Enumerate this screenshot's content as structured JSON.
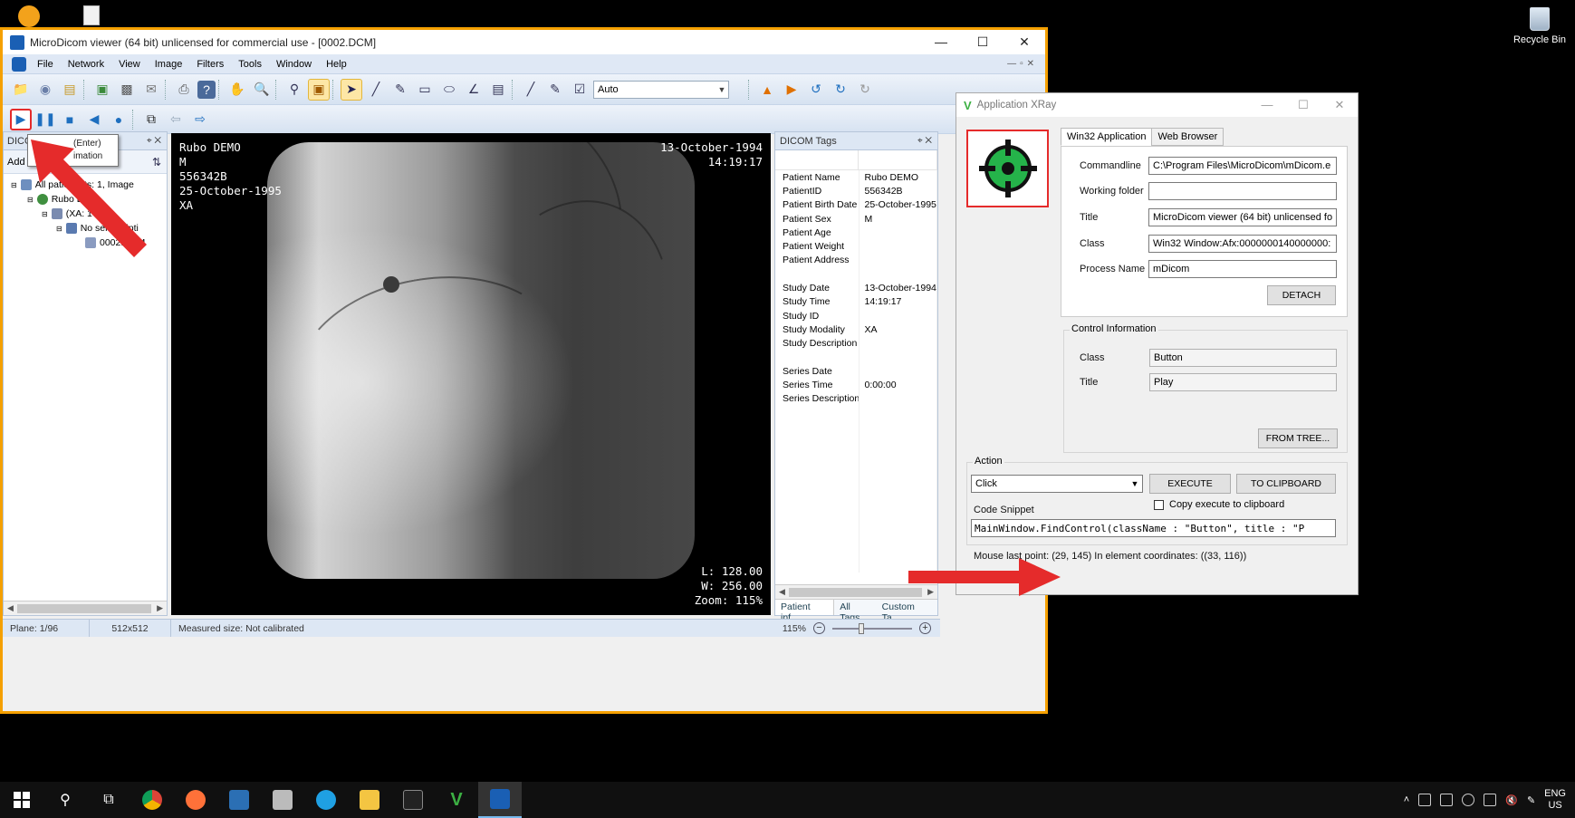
{
  "desktop": {
    "recycle_bin_label": "Recycle Bin"
  },
  "main_window": {
    "title": "MicroDicom viewer (64 bit) unlicensed for commercial use - [0002.DCM]",
    "menu": [
      "File",
      "Network",
      "View",
      "Image",
      "Filters",
      "Tools",
      "Window",
      "Help"
    ],
    "window_level_combo": "Auto",
    "tooltip": {
      "line1": "(Enter)",
      "line2": "imation"
    },
    "left_panel": {
      "title": "DICO",
      "add_label": "Add",
      "tree": [
        {
          "text": "All patie    ients: 1, Image",
          "level": 0
        },
        {
          "text": "Rubo De",
          "level": 1
        },
        {
          "text": "(XA: 1 se",
          "level": 2
        },
        {
          "text": "No serie    cripti",
          "level": 3
        },
        {
          "text": "0002.DCM",
          "level": 4
        }
      ]
    },
    "viewer": {
      "overlay_top_left": [
        "Rubo DEMO",
        "M",
        "556342B",
        "25-October-1995",
        "XA"
      ],
      "overlay_top_right": [
        "13-October-1994",
        "14:19:17"
      ],
      "overlay_bottom_right": [
        "L: 128.00",
        "W: 256.00",
        "Zoom: 115%"
      ]
    },
    "tags_panel": {
      "title": "DICOM Tags",
      "rows": [
        {
          "name": "Patient Name",
          "value": "Rubo DEMO"
        },
        {
          "name": "PatientID",
          "value": "556342B"
        },
        {
          "name": "Patient Birth Date",
          "value": "25-October-1995"
        },
        {
          "name": "Patient Sex",
          "value": "M"
        },
        {
          "name": "Patient Age",
          "value": ""
        },
        {
          "name": "Patient Weight",
          "value": ""
        },
        {
          "name": "Patient Address",
          "value": ""
        },
        {
          "name": "",
          "value": ""
        },
        {
          "name": "Study Date",
          "value": "13-October-1994"
        },
        {
          "name": "Study Time",
          "value": "14:19:17"
        },
        {
          "name": "Study ID",
          "value": ""
        },
        {
          "name": "Study Modality",
          "value": "XA"
        },
        {
          "name": "Study Description",
          "value": ""
        },
        {
          "name": "",
          "value": ""
        },
        {
          "name": "Series Date",
          "value": ""
        },
        {
          "name": "Series Time",
          "value": "0:00:00"
        },
        {
          "name": "Series Description",
          "value": ""
        }
      ],
      "tabs": [
        "Patient inf...",
        "All Tags",
        "Custom Ta..."
      ]
    },
    "status": {
      "plane": "Plane: 1/96",
      "size": "512x512",
      "measured": "Measured size: Not calibrated",
      "zoom": "115%",
      "zoom_slider_level": 0.35
    }
  },
  "xray_window": {
    "title": "Application XRay",
    "tabs": [
      "Win32 Application",
      "Web Browser"
    ],
    "fields": {
      "commandline_label": "Commandline",
      "commandline_value": "C:\\Program Files\\MicroDicom\\mDicom.e",
      "working_folder_label": "Working folder",
      "working_folder_value": "",
      "title_label": "Title",
      "title_value": "MicroDicom viewer (64 bit) unlicensed fo",
      "class_label": "Class",
      "class_value": "Win32 Window:Afx:0000000140000000:",
      "process_label": "Process Name",
      "process_value": "mDicom",
      "detach": "DETACH"
    },
    "control_info": {
      "group": "Control Information",
      "class_label": "Class",
      "class_value": "Button",
      "title_label": "Title",
      "title_value": "Play",
      "from_tree": "FROM TREE..."
    },
    "action": {
      "group": "Action",
      "selected": "Click",
      "execute": "EXECUTE",
      "to_clipboard": "TO CLIPBOARD",
      "copy_execute": "Copy execute to clipboard",
      "code_snippet_label": "Code Snippet",
      "code": "MainWindow.FindControl(className : \"Button\", title : \"P"
    },
    "mouse_info": "Mouse last point: (29, 145) In element coordinates: ((33, 116))",
    "ellipsis": "..."
  },
  "taskbar": {
    "lang_line1": "ENG",
    "lang_line2": "US"
  },
  "colors": {
    "accent_border": "#f5a000",
    "arrow_red": "#e52b2b",
    "target_green": "#25b34a"
  }
}
